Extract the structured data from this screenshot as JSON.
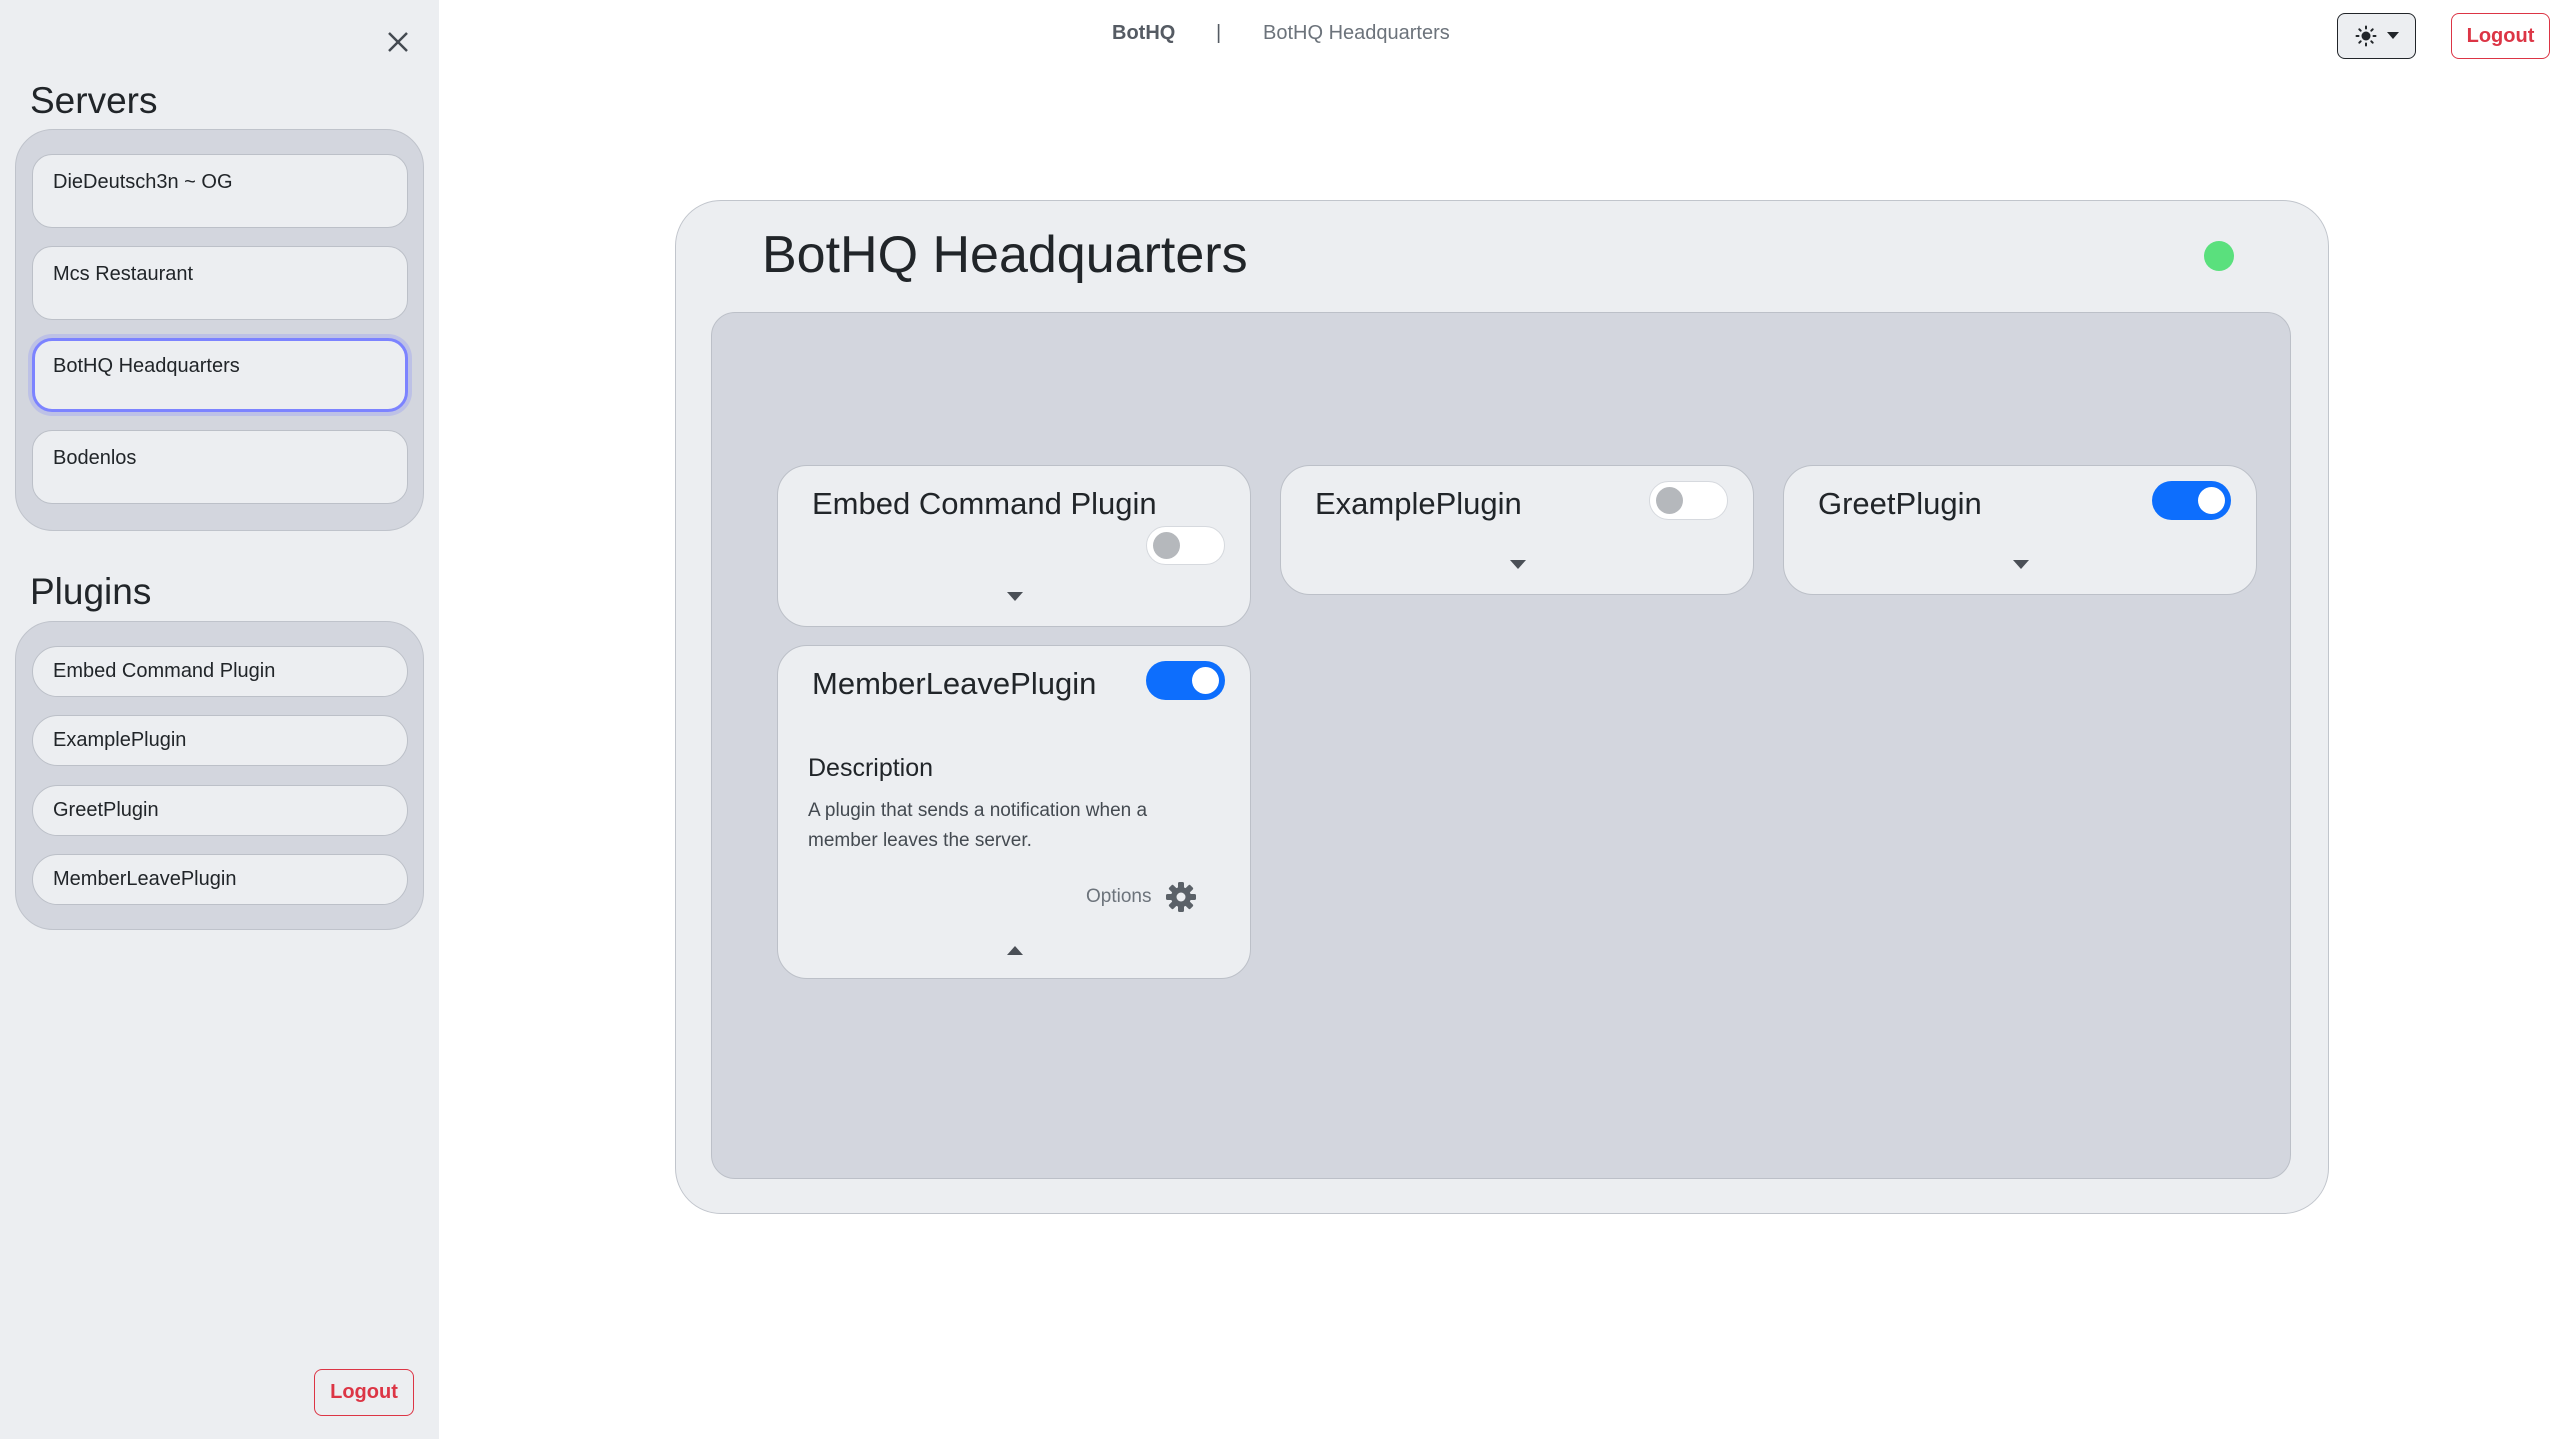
{
  "sidebar": {
    "servers_title": "Servers",
    "servers": [
      {
        "label": "DieDeutsch3n ~ OG",
        "active": false
      },
      {
        "label": "Mcs Restaurant",
        "active": false
      },
      {
        "label": "BotHQ Headquarters",
        "active": true
      },
      {
        "label": "Bodenlos",
        "active": false
      }
    ],
    "plugins_title": "Plugins",
    "plugins": [
      {
        "label": "Embed Command Plugin"
      },
      {
        "label": "ExamplePlugin"
      },
      {
        "label": "GreetPlugin"
      },
      {
        "label": "MemberLeavePlugin"
      }
    ],
    "logout_label": "Logout",
    "close_icon": "close-icon"
  },
  "header": {
    "brand": "BotHQ",
    "separator": "|",
    "current_server": "BotHQ Headquarters",
    "theme_icon": "sun-icon",
    "logout_label": "Logout"
  },
  "main": {
    "title": "BotHQ Headquarters",
    "status_color": "#5ae07d",
    "plugins": [
      {
        "name": "Embed Command Plugin",
        "enabled": false,
        "expanded": false
      },
      {
        "name": "ExamplePlugin",
        "enabled": false,
        "expanded": false
      },
      {
        "name": "GreetPlugin",
        "enabled": true,
        "expanded": false
      },
      {
        "name": "MemberLeavePlugin",
        "enabled": true,
        "expanded": true,
        "description_title": "Description",
        "description": "A plugin that sends a notification when a member leaves the server.",
        "options_label": "Options"
      }
    ]
  },
  "colors": {
    "accent": "#0d6efd",
    "danger": "#dc3545",
    "active_outline": "#7c83ff",
    "status_online": "#5ae07d"
  }
}
